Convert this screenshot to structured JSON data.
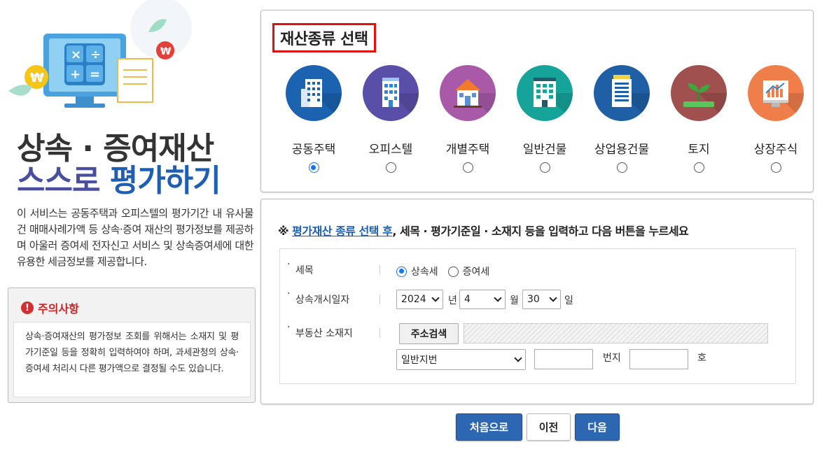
{
  "left": {
    "title_line1": "상속 · 증여재산",
    "title_line2_a": "스스로 ",
    "title_line2_b": "평가하기",
    "intro": "이 서비스는 공동주택과 오피스텔의 평가기간 내 유사물건 매매사례가액 등 상속·증여 재산의 평가정보를 제공하며 아울러 증여세 전자신고 서비스 및 상속증여세에 대한 유용한 세금정보를 제공합니다.",
    "caution_title": "주의사항",
    "caution_body": "상속·증여재산의 평가정보 조회를 위해서는 소재지 및 평가기준일 등을 정확히 입력하여야 하며, 과세관청의 상속·증여세 처리시 다른 평가액으로 결정될 수도 있습니다."
  },
  "selector": {
    "title": "재산종류 선택",
    "types": [
      {
        "label": "공동주택",
        "icon": "apartment-icon",
        "color": "#1b62b0",
        "selected": true
      },
      {
        "label": "오피스텔",
        "icon": "officetel-icon",
        "color": "#5a4fa8",
        "selected": false
      },
      {
        "label": "개별주택",
        "icon": "house-icon",
        "color": "#a85aa8",
        "selected": false
      },
      {
        "label": "일반건물",
        "icon": "building-icon",
        "color": "#16a39a",
        "selected": false
      },
      {
        "label": "상업용건물",
        "icon": "commercial-building-icon",
        "color": "#1f5fa6",
        "selected": false
      },
      {
        "label": "토지",
        "icon": "land-sprout-icon",
        "color": "#a0504e",
        "selected": false
      },
      {
        "label": "상장주식",
        "icon": "stock-chart-icon",
        "color": "#f07e4a",
        "selected": false
      }
    ]
  },
  "form": {
    "notice_mark": "※ ",
    "notice_highlight": "평가재산 종류 선택 후",
    "notice_rest": ", 세목 · 평가기준일 · 소재지 등을 입력하고 다음 버튼을 누르세요",
    "tax_label": "세목",
    "tax_options": [
      "상속세",
      "증여세"
    ],
    "date_label": "상속개시일자",
    "year": "2024",
    "year_unit": "년",
    "month": "4",
    "month_unit": "월",
    "day": "30",
    "day_unit": "일",
    "address_label": "부동산 소재지",
    "address_search": "주소검색",
    "lot_type": "일반지번",
    "bunji_unit": "번지",
    "ho_unit": "호"
  },
  "actions": {
    "home": "처음으로",
    "prev": "이전",
    "next": "다음"
  }
}
